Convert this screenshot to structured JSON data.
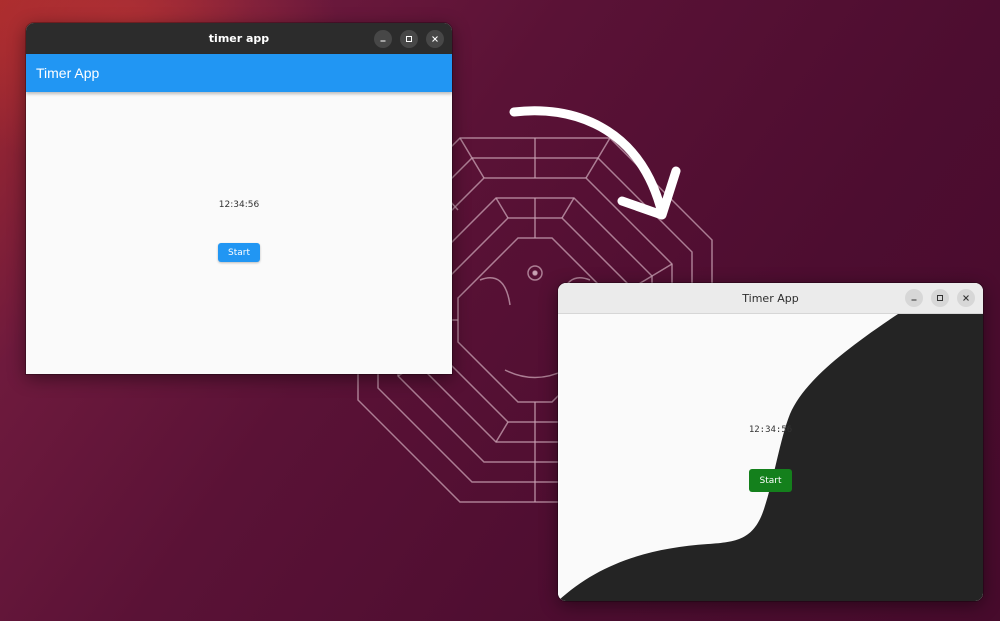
{
  "desktop": {
    "wallpaper_colors": {
      "base": "#4d0d30",
      "accent": "#a52a2d",
      "maze_line": "#c9a3b4"
    },
    "decoration": "hand-drawn-arrow"
  },
  "window_old": {
    "title": "timer app",
    "app_bar_title": "Timer App",
    "time_display": "12:34:56",
    "start_label": "Start",
    "colors": {
      "titlebar": "#2c2c2c",
      "app_bar": "#2196f3",
      "start_button": "#2196f3"
    },
    "controls": [
      "minimize-icon",
      "maximize-icon",
      "close-icon"
    ]
  },
  "window_new": {
    "title": "Timer App",
    "time_display": "12:34:56",
    "start_label": "Start",
    "colors": {
      "titlebar": "#ebebeb",
      "background_light": "#fafafa",
      "background_dark": "#242424",
      "start_button": "#14801c"
    },
    "controls": [
      "minimize-icon",
      "maximize-icon",
      "close-icon"
    ]
  }
}
